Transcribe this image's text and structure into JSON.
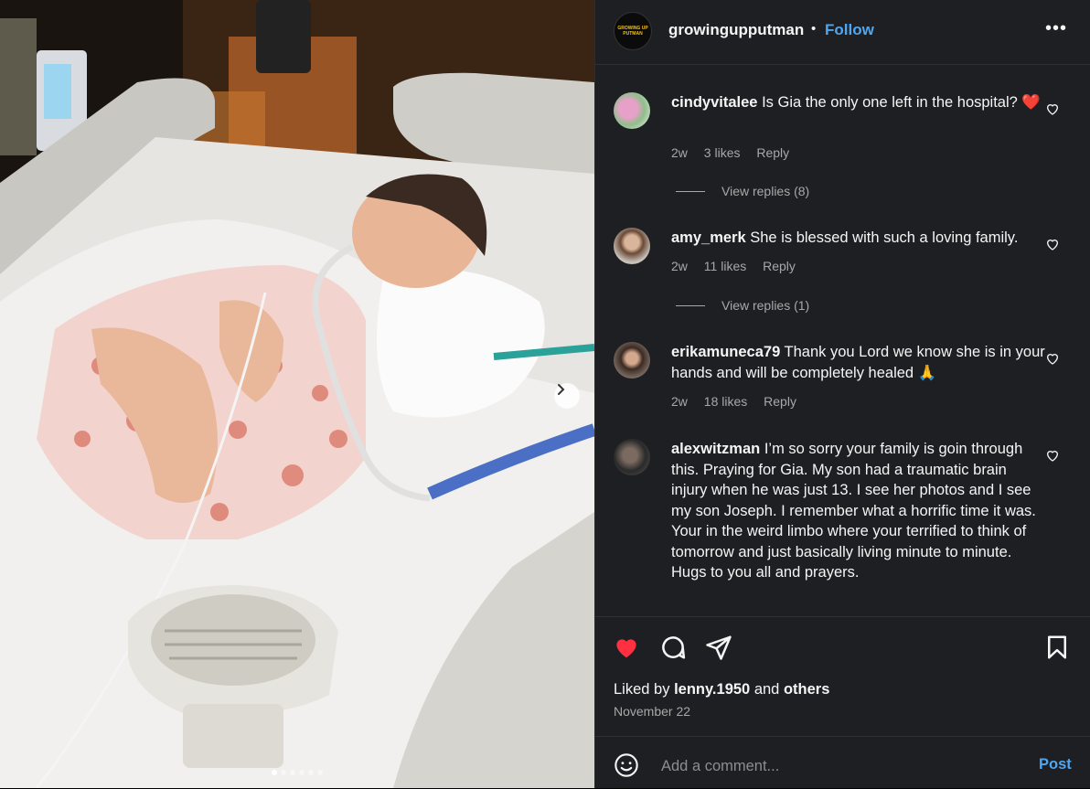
{
  "post": {
    "username": "growingupputman",
    "avatar_text": "GROWING UP PUTMAN",
    "separator": "•",
    "follow_label": "Follow",
    "more_label": "•••"
  },
  "photo": {
    "carousel": {
      "total": 6,
      "current": 1
    }
  },
  "comments": [
    {
      "username": "cindyvitalee",
      "text": "Is Gia the only one left in the hospital? ❤️",
      "time": "2w",
      "likes": "3 likes",
      "reply_label": "Reply",
      "view_replies": "View replies (8)"
    },
    {
      "username": "amy_merk",
      "text": "She is blessed with such a loving family.",
      "time": "2w",
      "likes": "11 likes",
      "reply_label": "Reply",
      "view_replies": "View replies (1)"
    },
    {
      "username": "erikamuneca79",
      "text": "Thank you Lord we know she is in your hands and will be completely healed 🙏",
      "time": "2w",
      "likes": "18 likes",
      "reply_label": "Reply"
    },
    {
      "username": "alexwitzman",
      "text": "I’m so sorry your family is goin through this. Praying for Gia. My son had a traumatic brain injury when he was just 13. I see her photos and I see my son Joseph. I remember what a horrific time it was. Your in the weird limbo where your terrified to think of tomorrow and just basically living minute to minute. Hugs to you all and prayers."
    }
  ],
  "footer": {
    "liked_prefix": "Liked by",
    "liked_user": "lenny.1950",
    "liked_and": "and",
    "liked_others": "others",
    "date": "November 22",
    "comment_placeholder": "Add a comment...",
    "post_label": "Post"
  },
  "colors": {
    "accent": "#4ea7f0",
    "liked_heart": "#ff3040",
    "panel_bg": "#1e1f22",
    "muted_text": "#a8a8a8"
  }
}
